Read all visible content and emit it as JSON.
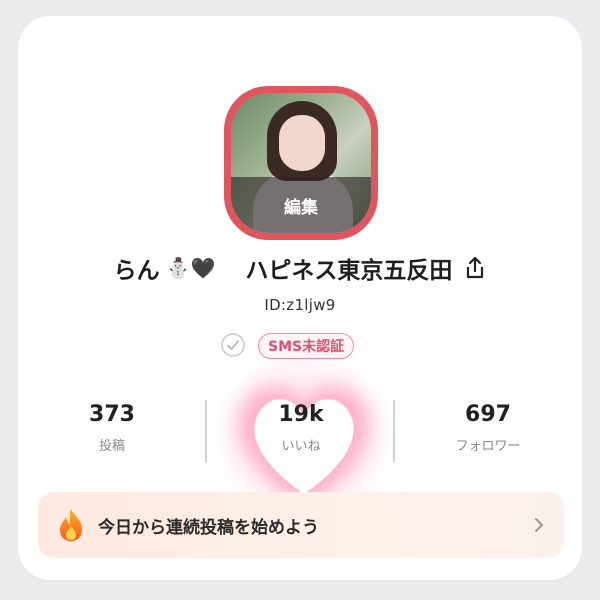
{
  "profile": {
    "edit_label": "編集",
    "name": "らん",
    "name_emojis": "⛄🖤",
    "shop_name": "ハピネス東京五反田",
    "user_id": "ID:z1ljw9",
    "sms_status": "SMS未認証"
  },
  "stats": [
    {
      "value": "373",
      "label": "投稿"
    },
    {
      "value": "19k",
      "label": "いいね"
    },
    {
      "value": "697",
      "label": "フォロワー"
    }
  ],
  "streak": {
    "text": "今日から連続投稿を始めよう"
  },
  "colors": {
    "avatar_ring": "#e0565f",
    "sms_badge": "#e2506e",
    "heart": "#ffb6ce"
  },
  "icons": {
    "share": "share-icon",
    "check": "check-circle-icon",
    "heart": "heart-icon",
    "fire": "fire-icon",
    "chevron": "chevron-right-icon"
  }
}
